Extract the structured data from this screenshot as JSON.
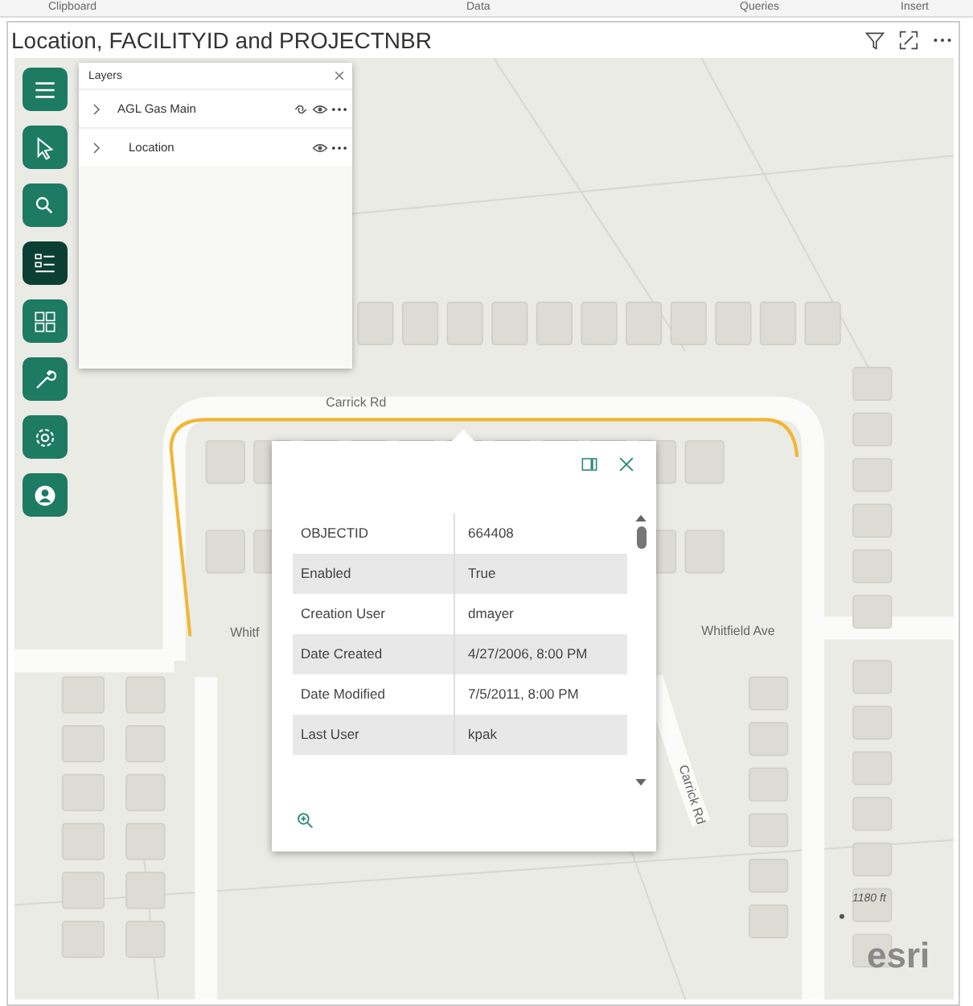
{
  "ribbon": [
    "Clipboard",
    "Data",
    "Queries",
    "Insert"
  ],
  "title": "Location, FACILITYID and PROJECTNBR",
  "toolbar": [
    {
      "kind": "menu",
      "selected": false
    },
    {
      "kind": "select",
      "selected": false
    },
    {
      "kind": "search",
      "selected": false
    },
    {
      "kind": "layers",
      "selected": true
    },
    {
      "kind": "basemap",
      "selected": false
    },
    {
      "kind": "tools",
      "selected": false
    },
    {
      "kind": "settings",
      "selected": false
    },
    {
      "kind": "account",
      "selected": false
    }
  ],
  "layers_panel": {
    "title": "Layers",
    "items": [
      {
        "name": "AGL Gas Main",
        "expanded": false,
        "link": true
      },
      {
        "name": "Location",
        "expanded": false,
        "link": false
      }
    ]
  },
  "map_labels": [
    {
      "text": "Carrick Rd",
      "kind": "horizontal"
    },
    {
      "text": "Whitf",
      "kind": "horizontal"
    },
    {
      "text": "Whitfield Ave",
      "kind": "horizontal"
    },
    {
      "text": "Carrick Rd",
      "kind": "rotated"
    }
  ],
  "popup": {
    "rows": [
      {
        "field": "OBJECTID",
        "value": "664408"
      },
      {
        "field": "Enabled",
        "value": "True"
      },
      {
        "field": "Creation User",
        "value": "dmayer"
      },
      {
        "field": "Date Created",
        "value": "4/27/2006, 8:00 PM"
      },
      {
        "field": "Date Modified",
        "value": "7/5/2011, 8:00 PM"
      },
      {
        "field": "Last User",
        "value": "kpak"
      }
    ]
  },
  "scale": "1180 ft",
  "attribution": "esri"
}
